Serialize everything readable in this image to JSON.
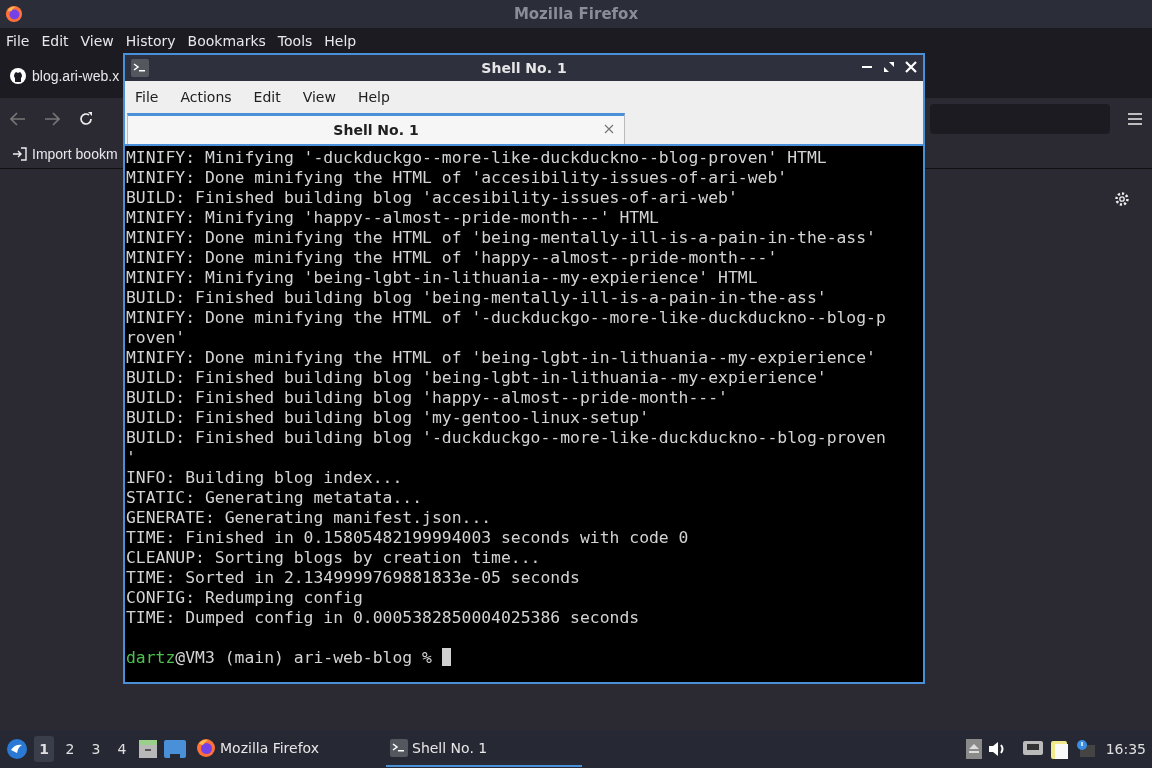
{
  "browser": {
    "title": "Mozilla Firefox",
    "menu": [
      "File",
      "Edit",
      "View",
      "History",
      "Bookmarks",
      "Tools",
      "Help"
    ],
    "tab": {
      "label": "blog.ari-web.x"
    },
    "bookmark": "Import bookm"
  },
  "terminal": {
    "title": "Shell No. 1",
    "menu": [
      "File",
      "Actions",
      "Edit",
      "View",
      "Help"
    ],
    "tabs": [
      {
        "label": "Shell No. 1",
        "selected": true
      }
    ],
    "lines": [
      "MINIFY: Minifying '-duckduckgo--more-like-duckduckno--blog-proven' HTML",
      "MINIFY: Done minifying the HTML of 'accesibility-issues-of-ari-web'",
      "BUILD: Finished building blog 'accesibility-issues-of-ari-web'",
      "MINIFY: Minifying 'happy--almost--pride-month---' HTML",
      "MINIFY: Done minifying the HTML of 'being-mentally-ill-is-a-pain-in-the-ass'",
      "MINIFY: Done minifying the HTML of 'happy--almost--pride-month---'",
      "MINIFY: Minifying 'being-lgbt-in-lithuania--my-expierience' HTML",
      "BUILD: Finished building blog 'being-mentally-ill-is-a-pain-in-the-ass'",
      "MINIFY: Done minifying the HTML of '-duckduckgo--more-like-duckduckno--blog-p",
      "roven'",
      "MINIFY: Done minifying the HTML of 'being-lgbt-in-lithuania--my-expierience'",
      "BUILD: Finished building blog 'being-lgbt-in-lithuania--my-expierience'",
      "BUILD: Finished building blog 'happy--almost--pride-month---'",
      "BUILD: Finished building blog 'my-gentoo-linux-setup'",
      "BUILD: Finished building blog '-duckduckgo--more-like-duckduckno--blog-proven",
      "'",
      "INFO: Building blog index...",
      "STATIC: Generating metatata...",
      "GENERATE: Generating manifest.json...",
      "TIME: Finished in 0.15805482199994003 seconds with code 0",
      "CLEANUP: Sorting blogs by creation time...",
      "TIME: Sorted in 2.1349999769881833e-05 seconds",
      "CONFIG: Redumping config",
      "TIME: Dumped config in 0.0005382850004025386 seconds"
    ],
    "prompt": {
      "user": "dartz",
      "rest": "@VM3 (main) ari-web-blog %"
    }
  },
  "taskbar": {
    "workspaces": [
      {
        "label": "1",
        "selected": true
      },
      {
        "label": "2",
        "selected": false
      },
      {
        "label": "3",
        "selected": false
      },
      {
        "label": "4",
        "selected": false
      }
    ],
    "tasks": [
      {
        "label": "Mozilla Firefox",
        "kind": "firefox",
        "selected": false
      },
      {
        "label": "Shell No. 1",
        "kind": "shell",
        "selected": true
      }
    ],
    "clock": "16:35"
  }
}
